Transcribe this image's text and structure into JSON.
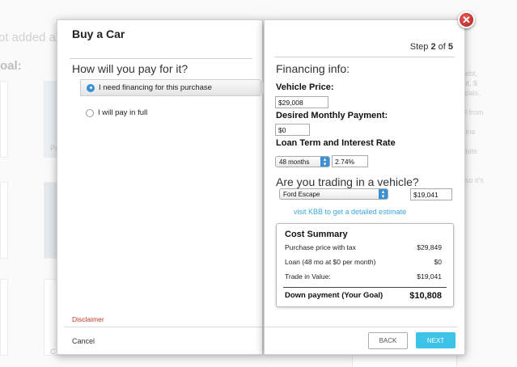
{
  "background": {
    "text1": "ot added an",
    "text2": "oal:",
    "right_lines": [
      "of debt,",
      "ment, $",
      "al goals.",
      "goal from",
      "ermine",
      "nd date",
      "d.",
      "unt so it's"
    ],
    "cap1": "Pa",
    "cap2": "C"
  },
  "modal": {
    "title": "Buy a Car",
    "question": "How will you pay for it?",
    "options": [
      {
        "label": "I need financing for this purchase",
        "selected": true
      },
      {
        "label": "I will pay in full",
        "selected": false
      }
    ],
    "disclaimer": "Disclaimer",
    "cancel": "Cancel",
    "close_icon": "close-icon"
  },
  "step": {
    "prefix": "Step",
    "current": "2",
    "of": "of",
    "total": "5"
  },
  "financing": {
    "heading": "Financing info:",
    "vehicle_price_label": "Vehicle Price:",
    "vehicle_price": "$29,008",
    "monthly_label": "Desired Monthly Payment:",
    "monthly": "$0",
    "loan_label": "Loan Term and Interest Rate",
    "term": "48 months",
    "rate": "2.74%"
  },
  "trade": {
    "question": "Are you trading in a vehicle?",
    "vehicle": "Ford Escape",
    "value": "$19,041",
    "kbb_link": "visit KBB to get a detailed estimate"
  },
  "summary": {
    "title": "Cost Summary",
    "rows": [
      {
        "label": "Purchase price with tax",
        "value": "$29,849"
      },
      {
        "label": "Loan (48 mo at $0 per month)",
        "value": "$0"
      },
      {
        "label": "Trade in Value:",
        "value": "$19,041"
      }
    ],
    "total_label": "Down payment (Your Goal)",
    "total_value": "$10,808"
  },
  "buttons": {
    "back": "BACK",
    "next": "NEXT"
  },
  "colors": {
    "accent": "#3dc3e8",
    "link": "#3aa7d8",
    "select_blue": "#3a8fd6",
    "disclaimer": "#c0392b",
    "close": "#c62828"
  }
}
